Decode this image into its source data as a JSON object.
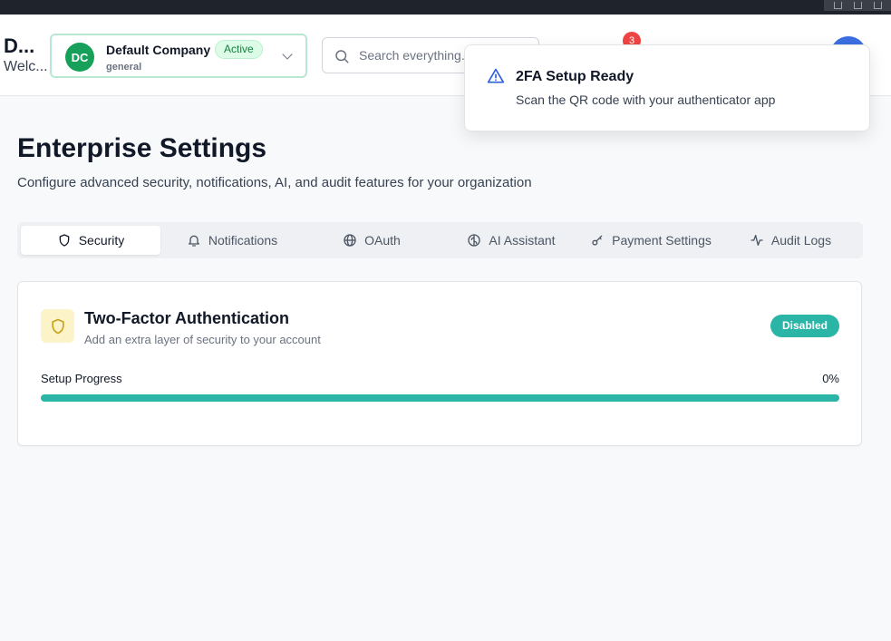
{
  "header": {
    "app_name": "D...",
    "welcome": "Welc...",
    "company": {
      "initials": "DC",
      "name": "Default Company",
      "type": "general",
      "status": "Active"
    },
    "search": {
      "placeholder": "Search everything...",
      "value": ""
    },
    "notifications": {
      "count": "3"
    }
  },
  "toast": {
    "title": "2FA Setup Ready",
    "description": "Scan the QR code with your authenticator app"
  },
  "page": {
    "title": "Enterprise Settings",
    "subtitle": "Configure advanced security, notifications, AI, and audit features for your organization"
  },
  "tabs": [
    {
      "label": "Security",
      "icon": "shield-icon",
      "active": true
    },
    {
      "label": "Notifications",
      "icon": "bell-icon",
      "active": false
    },
    {
      "label": "OAuth",
      "icon": "globe-icon",
      "active": false
    },
    {
      "label": "AI Assistant",
      "icon": "brain-icon",
      "active": false
    },
    {
      "label": "Payment Settings",
      "icon": "key-icon",
      "active": false
    },
    {
      "label": "Audit Logs",
      "icon": "activity-icon",
      "active": false
    }
  ],
  "two_factor": {
    "title": "Two-Factor Authentication",
    "description": "Add an extra layer of security to your account",
    "status": "Disabled",
    "progress_label": "Setup Progress",
    "progress_text": "0%",
    "progress_fraction": 0
  },
  "colors": {
    "accent": "#2bb5a6",
    "company_avatar": "#16a05a",
    "badge_red": "#ef4444",
    "warning_icon_bg": "#fdf3c8"
  }
}
